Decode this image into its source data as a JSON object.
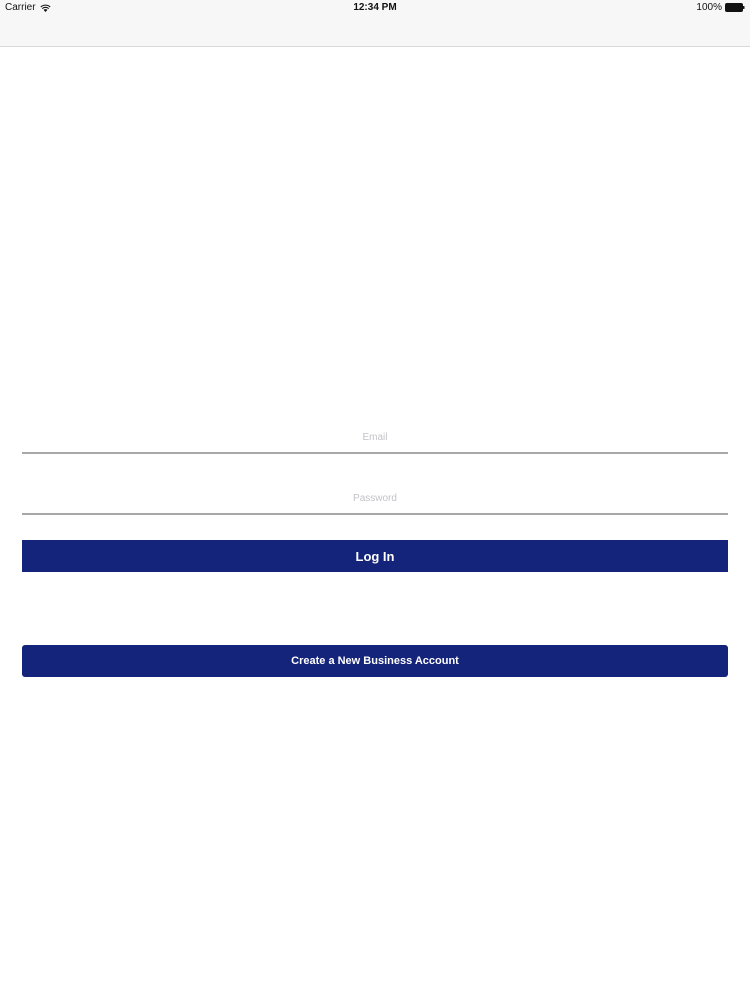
{
  "status_bar": {
    "carrier": "Carrier",
    "time": "12:34 PM",
    "battery": "100%"
  },
  "login": {
    "email_placeholder": "Email",
    "password_placeholder": "Password",
    "login_label": "Log In",
    "create_account_label": "Create a New Business Account"
  },
  "colors": {
    "primary_button": "#14247a",
    "field_underline": "#a8a8a8",
    "bar_background": "#f7f7f8"
  }
}
